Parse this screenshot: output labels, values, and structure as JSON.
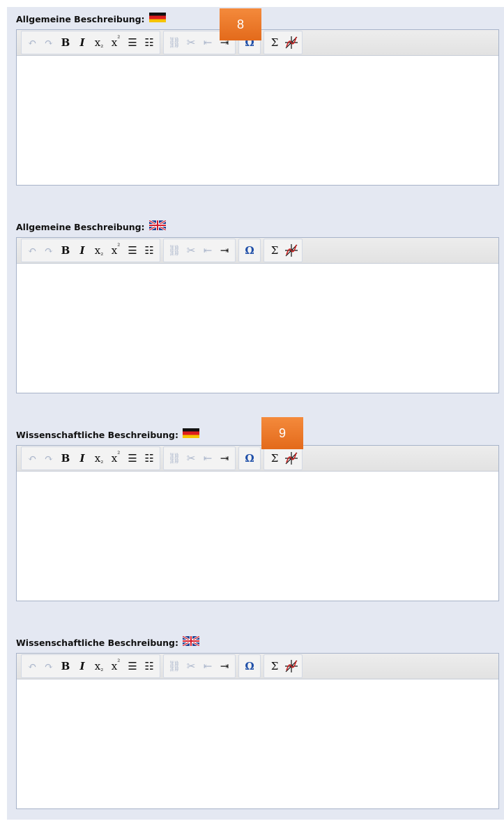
{
  "editors": [
    {
      "label": "Allgemeine Beschreibung:",
      "flag": "flag-de-icon"
    },
    {
      "label": "Allgemeine Beschreibung:",
      "flag": "flag-uk-icon"
    },
    {
      "label": "Wissenschaftliche Beschreibung:",
      "flag": "flag-de-icon"
    },
    {
      "label": "Wissenschaftliche Beschreibung:",
      "flag": "flag-uk-icon"
    }
  ],
  "badges": [
    "8",
    "9"
  ],
  "toolbar": {
    "bold": "B",
    "italic": "I",
    "subscript": "x",
    "superscript": "x",
    "special_char": "Ω",
    "sum": "Σ"
  },
  "colors": {
    "panel": "#e4e8f2",
    "toolbar": "#e2e2e2",
    "badge": "#ef7b2c"
  }
}
